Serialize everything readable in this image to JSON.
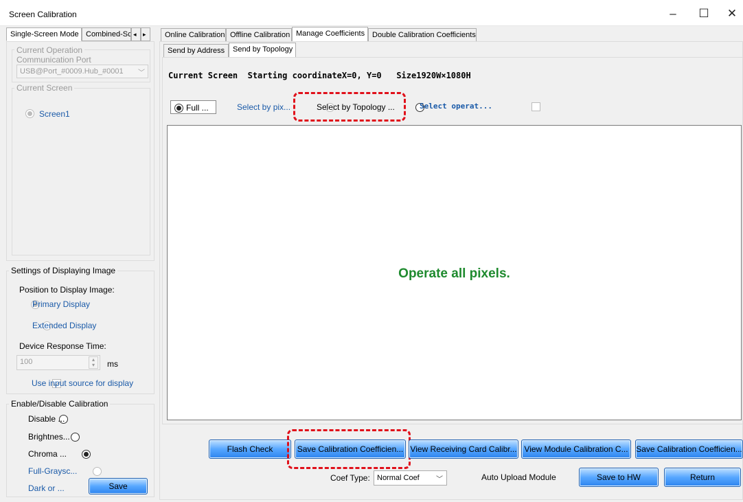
{
  "window": {
    "title": "Screen Calibration",
    "minimize": "–",
    "maximize": "☐",
    "close": "✕"
  },
  "left_tabs": {
    "single": "Single-Screen Mode",
    "combined": "Combined-Sc",
    "arrow_left": "◂",
    "arrow_right": "▸"
  },
  "current_operation": {
    "legend": "Current Operation",
    "port_label": "Communication Port",
    "port_value": "USB@Port_#0009.Hub_#0001"
  },
  "current_screen": {
    "legend": "Current Screen",
    "screen": "Screen1"
  },
  "display_settings": {
    "legend": "Settings of Displaying Image",
    "position_label": "Position to Display Image:",
    "primary": "Primary Display",
    "extended": "Extended Display",
    "response_label": "Device Response Time:",
    "response_value": "100",
    "ms": "ms",
    "use_input": "Use input source for display"
  },
  "calibration": {
    "legend": "Enable/Disable Calibration",
    "disable": "Disable ...",
    "brightness": "Brightnes...",
    "chroma": "Chroma ...",
    "full_gray": "Full-Graysc...",
    "dark": "Dark or ...",
    "save": "Save"
  },
  "top_tabs": [
    "Online Calibration",
    "Offline Calibration",
    "Manage Coefficients",
    "Double Calibration Coefficients"
  ],
  "sub_tabs": [
    "Send by Address",
    "Send by Topology"
  ],
  "screen_info": "Current Screen  Starting coordinateX=0, Y=0   Size1920W×1080H",
  "options": {
    "full": "Full ...",
    "by_pixel": "Select by pix...",
    "by_topology": "Select by Topology ...",
    "select_op": "Select operat..."
  },
  "canvas_message": "Operate all pixels.",
  "buttons": {
    "flash": "Flash Check",
    "save_coef": "Save Calibration Coefficien...",
    "view_recv": "View Receiving Card Calibr...",
    "view_module": "View Module Calibration C...",
    "save_coef2": "Save Calibration Coefficien...",
    "save_hw": "Save to HW",
    "return": "Return"
  },
  "coef": {
    "label": "Coef Type:",
    "value": "Normal Coef",
    "auto_upload": "Auto Upload Module"
  },
  "colors": {
    "accent_green": "#1e8a2e",
    "highlight_red": "#e0101a"
  }
}
